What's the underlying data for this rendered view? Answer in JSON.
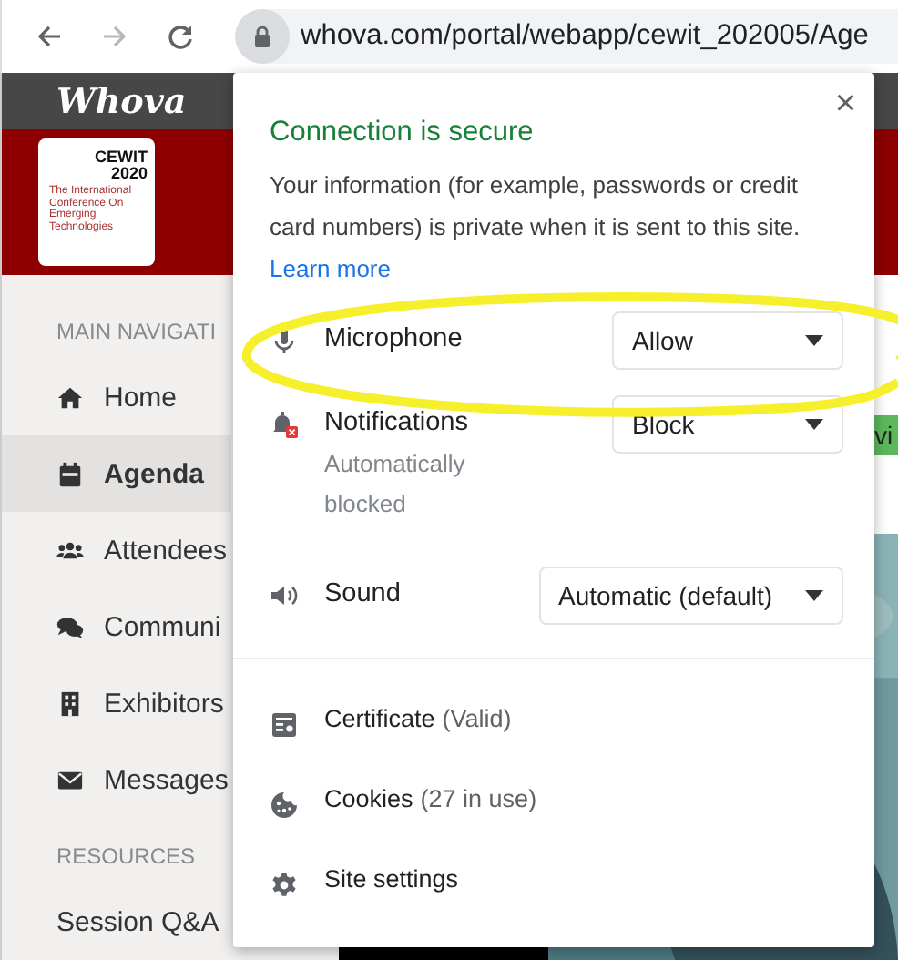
{
  "browser": {
    "nav": [
      {
        "kind": "back",
        "disabled": false
      },
      {
        "kind": "forward",
        "disabled": true
      },
      {
        "kind": "reload",
        "disabled": false
      }
    ],
    "url": "whova.com/portal/webapp/cewit_202005/Age"
  },
  "site": {
    "logo": "Whova",
    "banner": {
      "title": "CEWIT",
      "year": "2020",
      "subtitle": "The International Conference On Emerging Technologies"
    },
    "sidebar": {
      "sections": [
        {
          "heading": "MAIN NAVIGATI",
          "items": [
            {
              "label": "Home",
              "kind": "home",
              "selected": false
            },
            {
              "label": "Agenda",
              "kind": "agenda",
              "selected": true
            },
            {
              "label": "Attendees",
              "kind": "people",
              "selected": false
            },
            {
              "label": "Communi",
              "kind": "chat",
              "selected": false
            },
            {
              "label": "Exhibitors",
              "kind": "building",
              "selected": false
            },
            {
              "label": "Messages",
              "kind": "mail",
              "selected": false
            }
          ]
        },
        {
          "heading": "RESOURCES",
          "items": [
            {
              "label": "Session Q&A",
              "kind": "plain",
              "selected": false
            }
          ]
        }
      ]
    },
    "tab_strip": "vi"
  },
  "popup": {
    "close": "×",
    "title": "Connection is secure",
    "description": "Your information (for example, passwords or credit card numbers) is private when it is sent to this site.",
    "link": "Learn more",
    "permissions": [
      {
        "kind": "microphone",
        "label": "Microphone",
        "value": "Allow"
      },
      {
        "kind": "notifications",
        "label": "Notifications",
        "note": "Automatically blocked",
        "value": "Block"
      },
      {
        "kind": "sound",
        "label": "Sound",
        "value": "Automatic (default)"
      }
    ],
    "links": [
      {
        "kind": "certificate",
        "label": "Certificate",
        "note": "(Valid)"
      },
      {
        "kind": "cookies",
        "label": "Cookies",
        "note": "(27 in use)"
      },
      {
        "kind": "settings",
        "label": "Site settings"
      }
    ]
  }
}
